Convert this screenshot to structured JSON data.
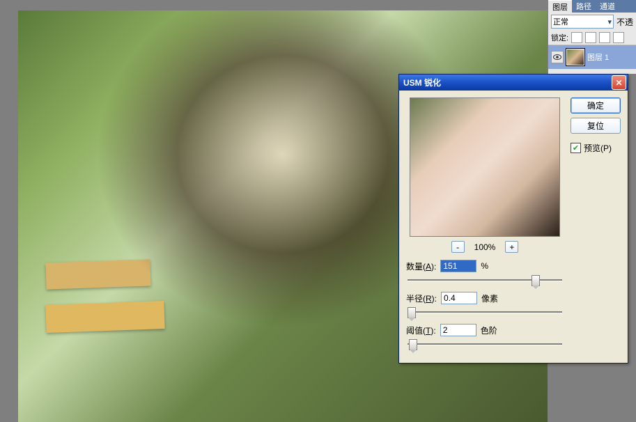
{
  "layers_panel": {
    "tabs": {
      "layers": "图层",
      "paths": "路径",
      "channels": "通道"
    },
    "blend_mode": "正常",
    "opacity_label": "不透",
    "lock_label": "锁定:",
    "layer_name": "图层 1"
  },
  "dialog": {
    "title": "USM 锐化",
    "ok": "确定",
    "reset": "复位",
    "preview_label": "预览(P)",
    "preview_checked": true,
    "zoom_value": "100%",
    "amount": {
      "label_pre": "数量(",
      "hotkey": "A",
      "label_post": "):",
      "value": "151",
      "unit": "%"
    },
    "radius": {
      "label_pre": "半径(",
      "hotkey": "R",
      "label_post": "):",
      "value": "0.4",
      "unit": "像素"
    },
    "threshold": {
      "label_pre": "阈值(",
      "hotkey": "T",
      "label_post": "):",
      "value": "2",
      "unit": "色阶"
    }
  }
}
